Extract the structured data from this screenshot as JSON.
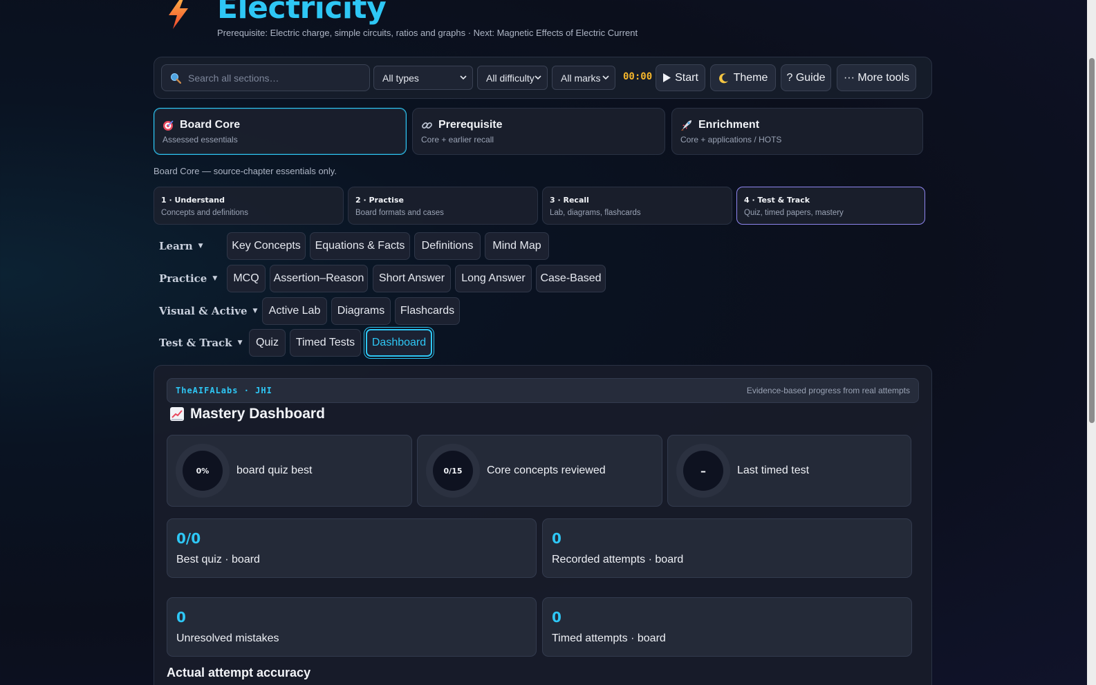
{
  "header": {
    "title": "Electricity",
    "subtitle": "Prerequisite: Electric charge, simple circuits, ratios and graphs · Next: Magnetic Effects of Electric Current",
    "icon": "lightning-bolt-icon"
  },
  "toolbar": {
    "search_placeholder": "Search all sections…",
    "type_filter": "All types",
    "difficulty_filter": "All difficulty",
    "marks_filter": "All marks",
    "timer": "00:00",
    "start_label": "Start",
    "theme_label": "Theme",
    "guide_label": "? Guide",
    "more_label": "··· More tools"
  },
  "modes": [
    {
      "title": "Board Core",
      "sub": "Assessed essentials",
      "icon": "target-icon",
      "active": true
    },
    {
      "title": "Prerequisite",
      "sub": "Core + earlier recall",
      "icon": "link-icon",
      "active": false
    },
    {
      "title": "Enrichment",
      "sub": "Core + applications / HOTS",
      "icon": "rocket-icon",
      "active": false
    }
  ],
  "mode_note": "Board Core — source-chapter essentials only.",
  "steps": [
    {
      "title": "1 · Understand",
      "sub": "Concepts and definitions"
    },
    {
      "title": "2 · Practise",
      "sub": "Board formats and cases"
    },
    {
      "title": "3 · Recall",
      "sub": "Lab, diagrams, flashcards"
    },
    {
      "title": "4 · Test & Track",
      "sub": "Quiz, timed papers, mastery"
    }
  ],
  "nav": {
    "learn": {
      "label": "Learn",
      "items": [
        "Key Concepts",
        "Equations & Facts",
        "Definitions",
        "Mind Map"
      ]
    },
    "practice": {
      "label": "Practice",
      "items": [
        "MCQ",
        "Assertion–Reason",
        "Short Answer",
        "Long Answer",
        "Case-Based"
      ]
    },
    "visual": {
      "label": "Visual & Active",
      "items": [
        "Active Lab",
        "Diagrams",
        "Flashcards"
      ]
    },
    "test": {
      "label": "Test & Track",
      "items": [
        "Quiz",
        "Timed Tests",
        "Dashboard"
      ]
    }
  },
  "dashboard": {
    "brand_left": "TheAIFALabs · JHI",
    "brand_right": "Evidence-based progress from real attempts",
    "title": "Mastery Dashboard",
    "rings": [
      {
        "value": "0%",
        "label": "board quiz best"
      },
      {
        "value": "0/15",
        "label": "Core concepts reviewed"
      },
      {
        "value": "–",
        "label": "Last timed test"
      }
    ],
    "stats": [
      {
        "value": "0/0",
        "label": "Best quiz · board"
      },
      {
        "value": "0",
        "label": "Recorded attempts · board"
      },
      {
        "value": "0",
        "label": "Unresolved mistakes"
      },
      {
        "value": "0",
        "label": "Timed attempts · board"
      }
    ],
    "section_title": "Actual attempt accuracy"
  },
  "colors": {
    "accent": "#2ec7f5",
    "timer": "#f5b62c",
    "step_active": "#8f86f0"
  }
}
